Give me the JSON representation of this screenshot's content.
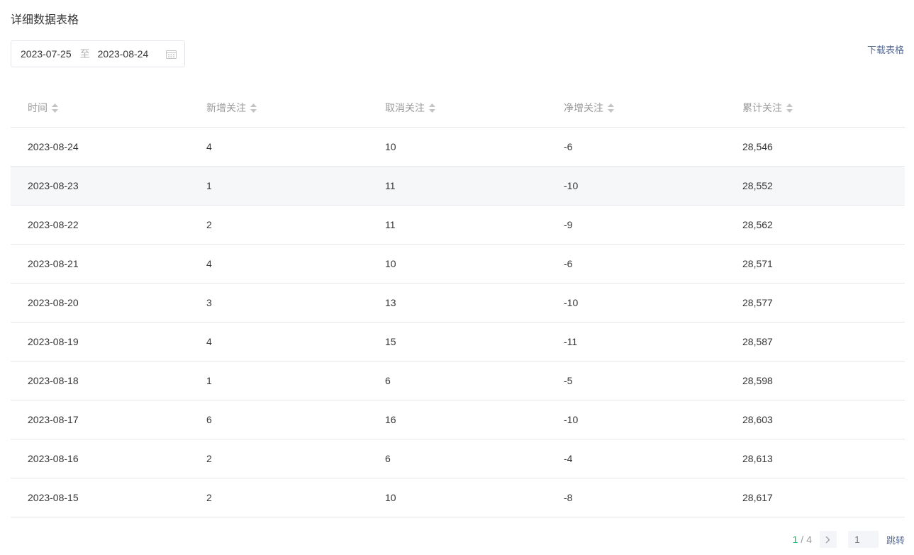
{
  "title": "详细数据表格",
  "date_range": {
    "start": "2023-07-25",
    "separator": "至",
    "end": "2023-08-24"
  },
  "download_label": "下载表格",
  "table": {
    "headers": [
      "时间",
      "新增关注",
      "取消关注",
      "净增关注",
      "累计关注"
    ],
    "rows": [
      [
        "2023-08-24",
        "4",
        "10",
        "-6",
        "28,546"
      ],
      [
        "2023-08-23",
        "1",
        "11",
        "-10",
        "28,552"
      ],
      [
        "2023-08-22",
        "2",
        "11",
        "-9",
        "28,562"
      ],
      [
        "2023-08-21",
        "4",
        "10",
        "-6",
        "28,571"
      ],
      [
        "2023-08-20",
        "3",
        "13",
        "-10",
        "28,577"
      ],
      [
        "2023-08-19",
        "4",
        "15",
        "-11",
        "28,587"
      ],
      [
        "2023-08-18",
        "1",
        "6",
        "-5",
        "28,598"
      ],
      [
        "2023-08-17",
        "6",
        "16",
        "-10",
        "28,603"
      ],
      [
        "2023-08-16",
        "2",
        "6",
        "-4",
        "28,613"
      ],
      [
        "2023-08-15",
        "2",
        "10",
        "-8",
        "28,617"
      ]
    ]
  },
  "pagination": {
    "current": "1",
    "separator": "/",
    "total": "4",
    "input_placeholder": "1",
    "jump_label": "跳转"
  },
  "colors": {
    "accent": "#07c160",
    "link": "#576b95"
  }
}
